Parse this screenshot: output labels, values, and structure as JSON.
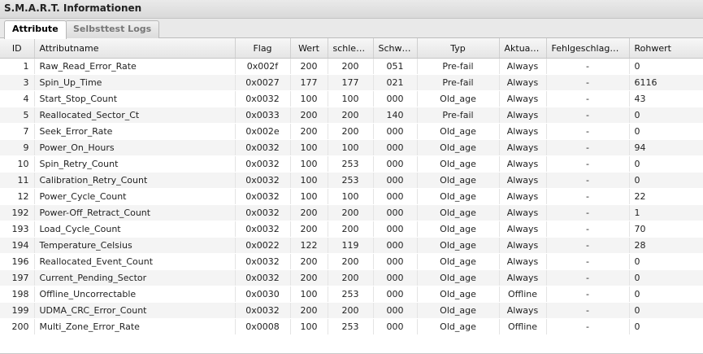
{
  "panel": {
    "title": "S.M.A.R.T. Informationen"
  },
  "tabs": [
    {
      "label": "Attribute",
      "active": true
    },
    {
      "label": "Selbsttest Logs",
      "active": false
    }
  ],
  "columns": [
    "ID",
    "Attributname",
    "Flag",
    "Wert",
    "schlec...",
    "Schwelle",
    "Typ",
    "Aktualis...",
    "Fehlgeschlagen ...",
    "Rohwert"
  ],
  "rows": [
    [
      "1",
      "Raw_Read_Error_Rate",
      "0x002f",
      "200",
      "200",
      "051",
      "Pre-fail",
      "Always",
      "-",
      "0"
    ],
    [
      "3",
      "Spin_Up_Time",
      "0x0027",
      "177",
      "177",
      "021",
      "Pre-fail",
      "Always",
      "-",
      "6116"
    ],
    [
      "4",
      "Start_Stop_Count",
      "0x0032",
      "100",
      "100",
      "000",
      "Old_age",
      "Always",
      "-",
      "43"
    ],
    [
      "5",
      "Reallocated_Sector_Ct",
      "0x0033",
      "200",
      "200",
      "140",
      "Pre-fail",
      "Always",
      "-",
      "0"
    ],
    [
      "7",
      "Seek_Error_Rate",
      "0x002e",
      "200",
      "200",
      "000",
      "Old_age",
      "Always",
      "-",
      "0"
    ],
    [
      "9",
      "Power_On_Hours",
      "0x0032",
      "100",
      "100",
      "000",
      "Old_age",
      "Always",
      "-",
      "94"
    ],
    [
      "10",
      "Spin_Retry_Count",
      "0x0032",
      "100",
      "253",
      "000",
      "Old_age",
      "Always",
      "-",
      "0"
    ],
    [
      "11",
      "Calibration_Retry_Count",
      "0x0032",
      "100",
      "253",
      "000",
      "Old_age",
      "Always",
      "-",
      "0"
    ],
    [
      "12",
      "Power_Cycle_Count",
      "0x0032",
      "100",
      "100",
      "000",
      "Old_age",
      "Always",
      "-",
      "22"
    ],
    [
      "192",
      "Power-Off_Retract_Count",
      "0x0032",
      "200",
      "200",
      "000",
      "Old_age",
      "Always",
      "-",
      "1"
    ],
    [
      "193",
      "Load_Cycle_Count",
      "0x0032",
      "200",
      "200",
      "000",
      "Old_age",
      "Always",
      "-",
      "70"
    ],
    [
      "194",
      "Temperature_Celsius",
      "0x0022",
      "122",
      "119",
      "000",
      "Old_age",
      "Always",
      "-",
      "28"
    ],
    [
      "196",
      "Reallocated_Event_Count",
      "0x0032",
      "200",
      "200",
      "000",
      "Old_age",
      "Always",
      "-",
      "0"
    ],
    [
      "197",
      "Current_Pending_Sector",
      "0x0032",
      "200",
      "200",
      "000",
      "Old_age",
      "Always",
      "-",
      "0"
    ],
    [
      "198",
      "Offline_Uncorrectable",
      "0x0030",
      "100",
      "253",
      "000",
      "Old_age",
      "Offline",
      "-",
      "0"
    ],
    [
      "199",
      "UDMA_CRC_Error_Count",
      "0x0032",
      "200",
      "200",
      "000",
      "Old_age",
      "Always",
      "-",
      "0"
    ],
    [
      "200",
      "Multi_Zone_Error_Rate",
      "0x0008",
      "100",
      "253",
      "000",
      "Old_age",
      "Offline",
      "-",
      "0"
    ]
  ]
}
